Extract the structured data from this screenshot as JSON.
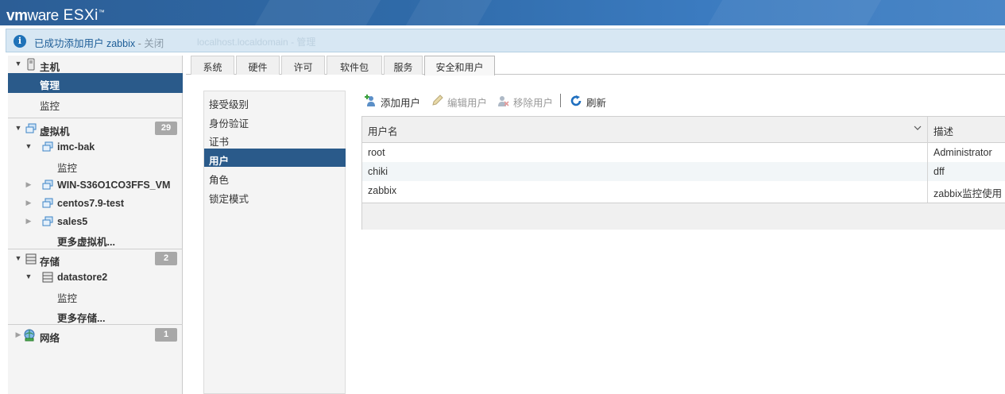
{
  "header": {
    "brand_vm": "vm",
    "brand_ware": "ware",
    "product": "ESXi",
    "trademark": "™"
  },
  "notification": {
    "message": "已成功添加用户 zabbix",
    "separator": " - ",
    "close_label": "关闭",
    "background_text": "localhost.localdomain - 管理"
  },
  "sidebar": {
    "host": {
      "label": "主机",
      "icon": "host-icon"
    },
    "manage": {
      "label": "管理"
    },
    "monitor": {
      "label": "监控"
    },
    "vms": {
      "label": "虚拟机",
      "badge": "29",
      "icon": "vm-icon"
    },
    "vm_list": [
      {
        "label": "imc-bak",
        "expanded": true,
        "child": "监控"
      },
      {
        "label": "WIN-S36O1CO3FFS_VM",
        "expanded": false
      },
      {
        "label": "centos7.9-test",
        "expanded": false
      },
      {
        "label": "sales5",
        "expanded": false
      }
    ],
    "more_vms": "更多虚拟机...",
    "storage": {
      "label": "存储",
      "badge": "2",
      "icon": "storage-icon"
    },
    "datastore": {
      "label": "datastore2",
      "child": "监控"
    },
    "more_storage": "更多存储...",
    "network": {
      "label": "网络",
      "badge": "1",
      "icon": "network-icon"
    }
  },
  "tabs": [
    {
      "label": "系统",
      "active": false
    },
    {
      "label": "硬件",
      "active": false
    },
    {
      "label": "许可",
      "active": false
    },
    {
      "label": "软件包",
      "active": false
    },
    {
      "label": "服务",
      "active": false
    },
    {
      "label": "安全和用户",
      "active": true
    }
  ],
  "subnav": [
    {
      "label": "接受级别",
      "selected": false
    },
    {
      "label": "身份验证",
      "selected": false
    },
    {
      "label": "证书",
      "selected": false
    },
    {
      "label": "用户",
      "selected": true
    },
    {
      "label": "角色",
      "selected": false
    },
    {
      "label": "锁定模式",
      "selected": false
    }
  ],
  "toolbar": {
    "add_user": "添加用户",
    "edit_user": "编辑用户",
    "remove_user": "移除用户",
    "refresh": "刷新"
  },
  "colors": {
    "accent": "#2a5a8a",
    "header": "#2f6aa8",
    "notify_bg": "#d7e7f3"
  },
  "users_table": {
    "columns": [
      "用户名",
      "描述"
    ],
    "rows": [
      {
        "username": "root",
        "description": "Administrator"
      },
      {
        "username": "chiki",
        "description": "dff"
      },
      {
        "username": "zabbix",
        "description": "zabbix监控使用"
      }
    ]
  }
}
